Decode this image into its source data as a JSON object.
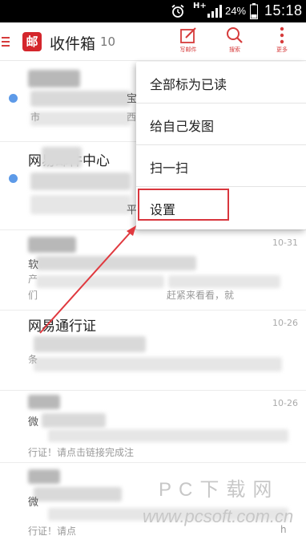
{
  "status_bar": {
    "network": "H+",
    "battery_percent": "24%",
    "time": "15:18"
  },
  "app_bar": {
    "title": "收件箱",
    "count": "10",
    "actions": {
      "compose_label": "写邮件",
      "search_label": "搜索",
      "more_label": "更多"
    }
  },
  "dropdown_menu": {
    "items": [
      {
        "label": "全部标为已读"
      },
      {
        "label": "给自己发图"
      },
      {
        "label": "扫一扫"
      },
      {
        "label": "设置"
      }
    ],
    "highlighted": "设置"
  },
  "mail_list": {
    "items": [
      {
        "sender": "",
        "date": "",
        "unread": true,
        "fragments": [
          "宝",
          "市",
          "西"
        ]
      },
      {
        "sender": "网易邮件中心",
        "date": "",
        "unread": true,
        "fragments": [
          "平"
        ]
      },
      {
        "sender": "",
        "date": "10-31",
        "unread": false,
        "fragments": [
          "软",
          "产",
          "们",
          "赶紧来看看，就"
        ]
      },
      {
        "sender": "网易通行证",
        "date": "10-26",
        "unread": false,
        "fragments": [
          "条"
        ]
      },
      {
        "sender": "",
        "date": "10-26",
        "unread": false,
        "fragments": [
          "微",
          "行证！请点击链接完成注"
        ]
      },
      {
        "sender": "",
        "date": "",
        "unread": false,
        "fragments": [
          "微",
          "行证！请点",
          "h"
        ]
      }
    ]
  },
  "watermark": {
    "main": "PC下载网",
    "sub": "www.pcsoft.com.cn"
  },
  "colors": {
    "accent": "#d63b3b",
    "unread_dot": "#5d9ae8",
    "highlight": "#d9363e"
  }
}
